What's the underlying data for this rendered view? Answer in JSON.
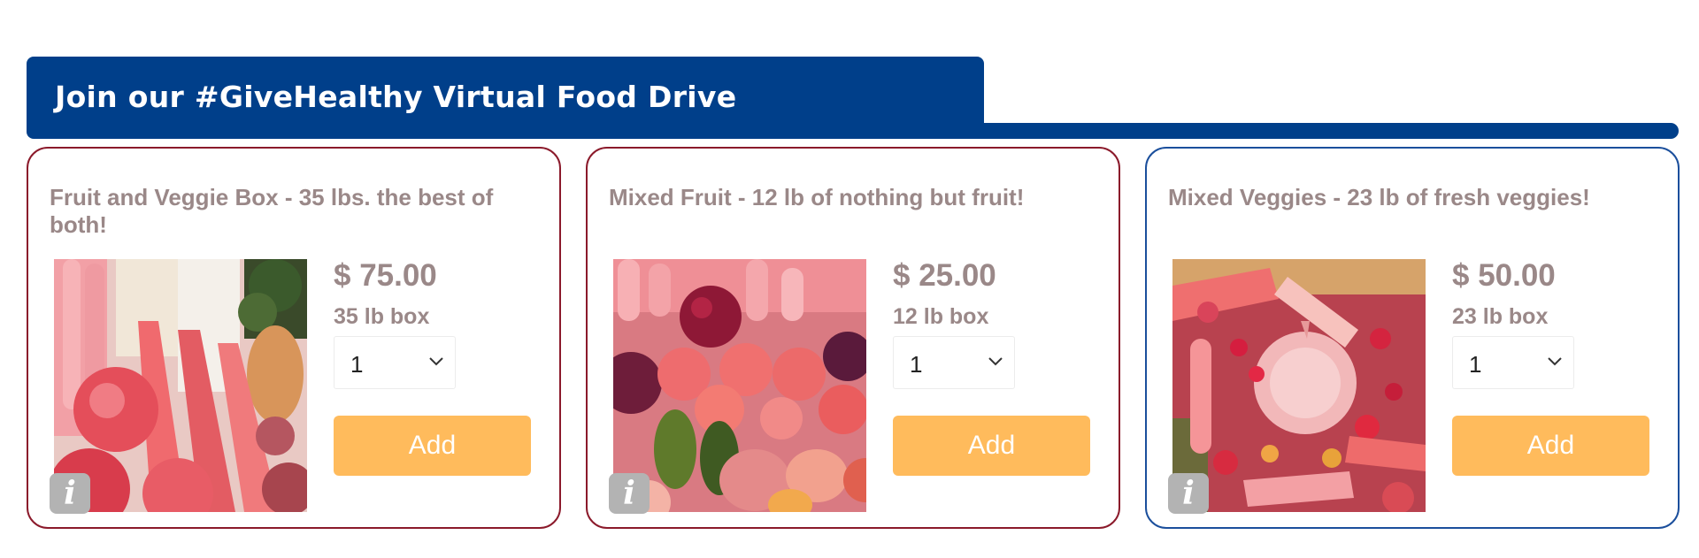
{
  "banner": {
    "title": "Join our #GiveHealthy Virtual Food Drive"
  },
  "products": [
    {
      "title": "Fruit and Veggie Box - 35 lbs. the best of both!",
      "price": "$ 75.00",
      "size": "35 lb box",
      "quantity": "1",
      "add_label": "Add",
      "info_label": "i",
      "selected": false
    },
    {
      "title": "Mixed Fruit - 12 lb of nothing but fruit!",
      "price": "$ 25.00",
      "size": "12 lb box",
      "quantity": "1",
      "add_label": "Add",
      "info_label": "i",
      "selected": false
    },
    {
      "title": "Mixed Veggies - 23 lb of fresh veggies!",
      "price": "$ 50.00",
      "size": "23 lb box",
      "quantity": "1",
      "add_label": "Add",
      "info_label": "i",
      "selected": true
    }
  ],
  "colors": {
    "banner": "#003f8a",
    "card_border": "#8b1a2b",
    "card_border_selected": "#1b4f9c",
    "text": "#9a8888",
    "button": "#ffbb5c"
  }
}
